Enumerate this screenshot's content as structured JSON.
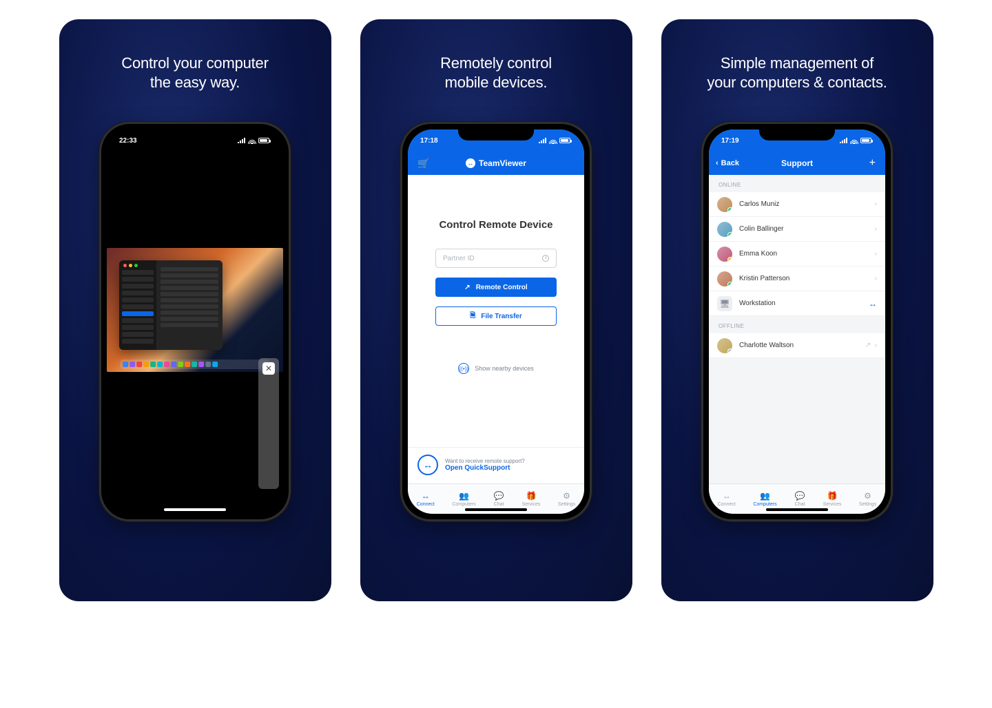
{
  "cards": [
    {
      "title": "Control your computer\nthe easy way."
    },
    {
      "title": "Remotely control\nmobile devices."
    },
    {
      "title": "Simple management of\nyour computers & contacts."
    }
  ],
  "phone1": {
    "time": "22:33"
  },
  "phone2": {
    "time": "17:18",
    "appTitle": "TeamViewer",
    "heading": "Control Remote Device",
    "partnerPlaceholder": "Partner ID",
    "remoteControl": "Remote Control",
    "fileTransfer": "File Transfer",
    "nearby": "Show nearby devices",
    "qs_l1": "Want to receive remote support?",
    "qs_l2": "Open QuickSupport",
    "tabs": [
      "Connect",
      "Computers",
      "Chat",
      "Services",
      "Settings"
    ]
  },
  "phone3": {
    "time": "17:19",
    "back": "Back",
    "title": "Support",
    "sectionOnline": "ONLINE",
    "sectionOffline": "OFFLINE",
    "contacts": {
      "online": [
        {
          "name": "Carlos Muniz",
          "status": "green",
          "hue": 30
        },
        {
          "name": "Colin Ballinger",
          "status": "green",
          "hue": 200
        },
        {
          "name": "Emma Koon",
          "status": "yellow",
          "hue": 340
        },
        {
          "name": "Kristin Patterson",
          "status": "green",
          "hue": 20
        }
      ],
      "workstation": "Workstation",
      "offline": [
        {
          "name": "Charlotte Waltson",
          "status": "gray",
          "hue": 45
        }
      ]
    },
    "tabs": [
      "Connect",
      "Computers",
      "Chat",
      "Services",
      "Settings"
    ]
  },
  "colors": {
    "blue": "#0a66e6",
    "green": "#2ac76a",
    "yellow": "#f0c22a",
    "gray": "#b9bec7"
  }
}
